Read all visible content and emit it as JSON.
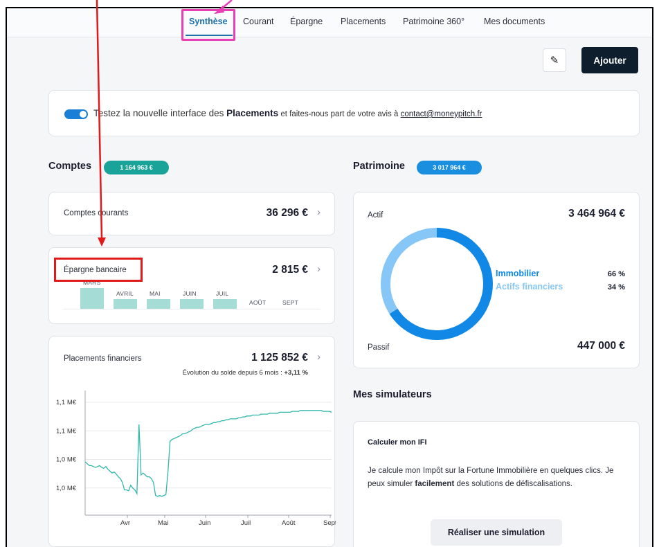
{
  "nav": {
    "tabs": [
      {
        "label": "Synthèse",
        "active": true
      },
      {
        "label": "Courant"
      },
      {
        "label": "Épargne"
      },
      {
        "label": "Placements"
      },
      {
        "label": "Patrimoine 360°"
      },
      {
        "label": "Mes documents"
      }
    ]
  },
  "toolbar": {
    "edit_icon": "pencil-icon",
    "add_label": "Ajouter"
  },
  "banner": {
    "pre": "Testez la nouvelle interface des ",
    "bold": "Placements",
    "post": " et faites-nous part de votre avis à ",
    "email": "contact@moneypitch.fr"
  },
  "comptes": {
    "title": "Comptes",
    "total": "1 164 963  €",
    "courants": {
      "label": "Comptes courants",
      "amount": "36 296  €"
    },
    "epargne": {
      "label": "Épargne bancaire",
      "amount": "2 815  €",
      "months": [
        "MARS",
        "AVRIL",
        "MAI",
        "JUIN",
        "JUIL",
        "AOÛT",
        "SEPT"
      ],
      "levels": [
        0.95,
        0.45,
        0.45,
        0.45,
        0.45,
        0,
        0
      ]
    },
    "placements": {
      "label": "Placements financiers",
      "amount": "1 125 852  €",
      "evolution_label": "Évolution du solde depuis 6 mois : ",
      "evolution_value": "+3,11 %"
    }
  },
  "chart_data": {
    "type": "line",
    "title": "",
    "ylabel": "",
    "xlabel": "",
    "y_tick_labels": [
      "1,1 M€",
      "1,1 M€",
      "1,0 M€",
      "1,0 M€"
    ],
    "x_tick_labels": [
      "Avr",
      "Mai",
      "Juin",
      "Juil",
      "Août",
      "Sept"
    ],
    "ylim": [
      0,
      100
    ],
    "series": [
      {
        "color": "#2fb8aa",
        "values": [
          40,
          38,
          36,
          36,
          35,
          34,
          35,
          36,
          34,
          33,
          35,
          32,
          30,
          28,
          29,
          27,
          24,
          22,
          18,
          10,
          10,
          9,
          15,
          12,
          10,
          6,
          80,
          26,
          28,
          26,
          24,
          24,
          22,
          18,
          4,
          3,
          4,
          3,
          4,
          5,
          30,
          62,
          64,
          65,
          66,
          67,
          68,
          70,
          70,
          71,
          72,
          73,
          75,
          76,
          77,
          77,
          78,
          79,
          80,
          80,
          80,
          81,
          82,
          82,
          83,
          83,
          84,
          84,
          85,
          85,
          86,
          86,
          86,
          86,
          87,
          87,
          88,
          88,
          89,
          89,
          89,
          90,
          90,
          90,
          90,
          91,
          91,
          91,
          91,
          92,
          92,
          92,
          92,
          92,
          93,
          93,
          93,
          93,
          93,
          93,
          94,
          94,
          94,
          94,
          95,
          95,
          95,
          95,
          95,
          95,
          95,
          95,
          95,
          95,
          95,
          94,
          94,
          94,
          94,
          93
        ]
      }
    ]
  },
  "patrimoine": {
    "title": "Patrimoine",
    "total": "3 017 964  €",
    "actif_label": "Actif",
    "actif_amount": "3 464 964  €",
    "passif_label": "Passif",
    "passif_amount": "447 000  €",
    "breakdown": [
      {
        "name": "Immobilier",
        "pct_label": "66 %",
        "value": 66,
        "color": "#1188e6"
      },
      {
        "name": "Actifs financiers",
        "pct_label": "34 %",
        "value": 34,
        "color": "#86c7f7"
      }
    ]
  },
  "simulateurs": {
    "title": "Mes simulateurs",
    "card_title": "Calculer mon IFI",
    "text_pre": "Je calcule mon Impôt sur la Fortune Immobilière en quelques clics. Je peux simuler ",
    "text_bold": "facilement",
    "text_post": " des solutions de défiscalisations.",
    "button": "Réaliser une simulation"
  }
}
